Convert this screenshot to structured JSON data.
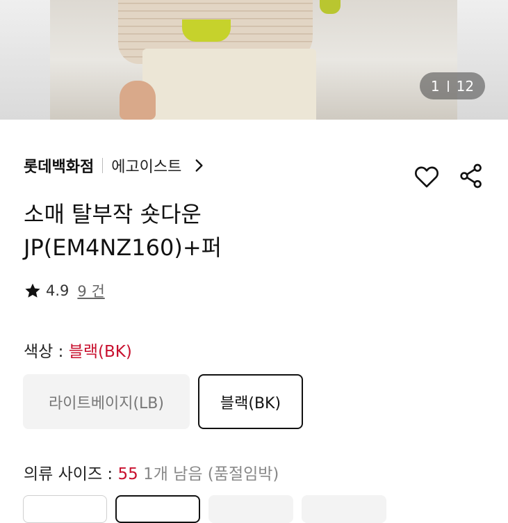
{
  "gallery": {
    "current": "1",
    "total": "12"
  },
  "product": {
    "brand": "롯데백화점",
    "sub_brand": "에고이스트",
    "title_line1": "소매 탈부작 숏다운",
    "title_line2": "JP(EM4NZ160)+퍼",
    "rating": "4.9",
    "review_count": "9 건"
  },
  "color": {
    "label": "색상 : ",
    "selected": "블랙(BK)",
    "options": [
      "라이트베이지(LB)",
      "블랙(BK)"
    ]
  },
  "size": {
    "label": "의류 사이즈 : ",
    "selected": "55",
    "stock_note": " 1개 남음 (품절임박)"
  },
  "icons": [
    "heart-icon",
    "share-icon",
    "star-icon",
    "chevron-right-icon"
  ],
  "colors": {
    "accent": "#c8102e",
    "selected_border": "#111111"
  }
}
